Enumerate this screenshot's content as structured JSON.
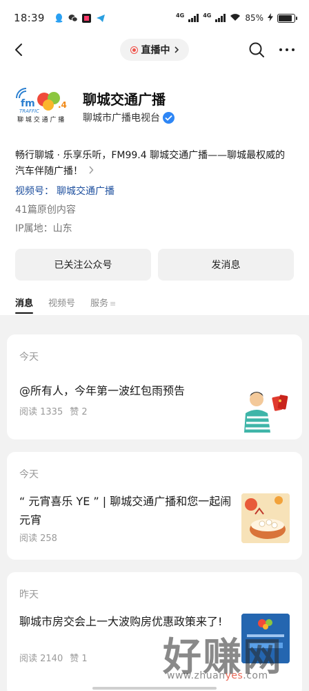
{
  "status_bar": {
    "time": "18:39",
    "battery": "85%",
    "net1": "4G",
    "net2": "4G"
  },
  "nav": {
    "live_label": "直播中"
  },
  "account": {
    "name": "聊城交通广播",
    "org": "聊城市广播电视台",
    "description": "畅行聊城 · 乐享乐听，FM99.4 聊城交通广播——聊城最权威的汽车伴随广播！",
    "channel_prefix": "视频号：",
    "channel_name": "聊城交通广播",
    "original_count": "41篇原创内容",
    "ip_location": "IP属地：山东",
    "logo_text": "TRAFFIC FM99.4",
    "logo_caption": "聊城交通广播"
  },
  "actions": {
    "follow": "已关注公众号",
    "message": "发消息"
  },
  "tabs": [
    "消息",
    "视频号",
    "服务"
  ],
  "articles": [
    {
      "date": "今天",
      "title": "@所有人，今年第一波红包雨预告",
      "reads": "阅读 1335",
      "likes": "赞 2"
    },
    {
      "date": "今天",
      "title": "“ 元宵喜乐 YE ” | 聊城交通广播和您一起闹元宵",
      "reads": "阅读 258",
      "likes": ""
    },
    {
      "date": "昨天",
      "title": "聊城市房交会上一大波购房优惠政策来了!",
      "reads": "阅读 2140",
      "likes": "赞 1"
    }
  ],
  "watermark": {
    "text": "好赚网",
    "url_a": "www.zhuan",
    "url_b": "yes",
    "url_c": ".com"
  },
  "colors": {
    "accent_link": "#1d4f9e",
    "verified": "#2e86f5",
    "live": "#f0524a"
  }
}
